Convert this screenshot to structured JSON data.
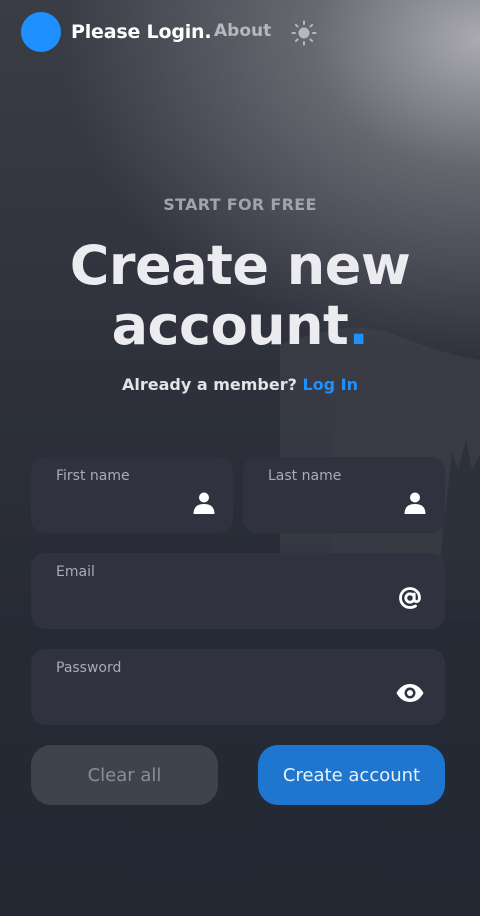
{
  "header": {
    "brand": "Please Login.",
    "nav_about": "About",
    "theme_icon": "sun-icon"
  },
  "hero": {
    "eyebrow": "START FOR FREE",
    "title_line1": "Create new",
    "title_line2": "account",
    "title_dot": ".",
    "member_text": "Already a member?",
    "login_link": "Log In"
  },
  "form": {
    "first_name": {
      "label": "First name",
      "value": "",
      "icon": "person-icon"
    },
    "last_name": {
      "label": "Last name",
      "value": "",
      "icon": "person-icon"
    },
    "email": {
      "label": "Email",
      "value": "",
      "icon": "at-sign-icon"
    },
    "password": {
      "label": "Password",
      "value": "",
      "icon": "eye-icon"
    }
  },
  "actions": {
    "clear_label": "Clear all",
    "create_label": "Create account"
  },
  "colors": {
    "accent": "#1e90ff",
    "field_bg": "#30333f",
    "background": "#262a35"
  }
}
